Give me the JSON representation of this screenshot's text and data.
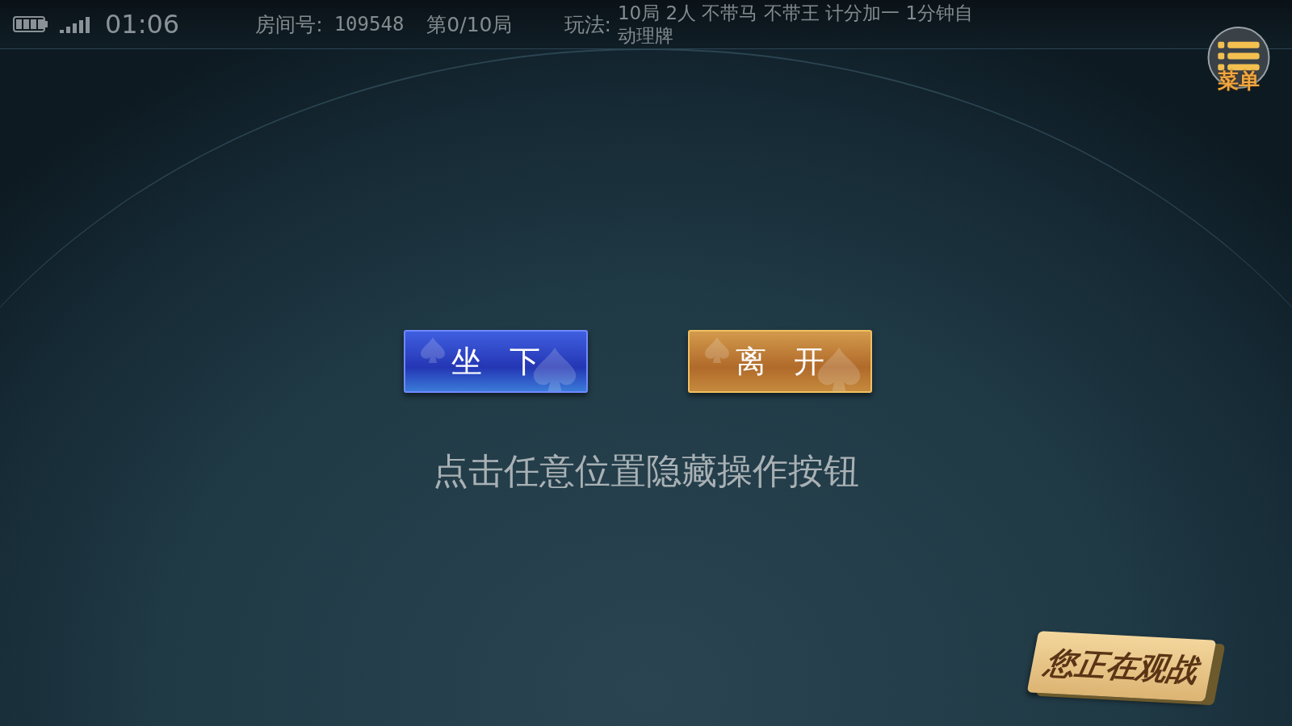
{
  "status_bar": {
    "time": "01:06"
  },
  "room": {
    "number_label": "房间号:",
    "number": "109548",
    "round": "第0/10局",
    "rules_label": "玩法:",
    "rules": "10局 2人 不带马 不带王 计分加一 1分钟自动理牌"
  },
  "menu_button": {
    "label": "菜单"
  },
  "actions": [
    {
      "label": "坐下",
      "kind": "sit"
    },
    {
      "label": "离开",
      "kind": "leave"
    }
  ],
  "hint": "点击任意位置隐藏操作按钮",
  "spectator_badge": "您正在观战"
}
